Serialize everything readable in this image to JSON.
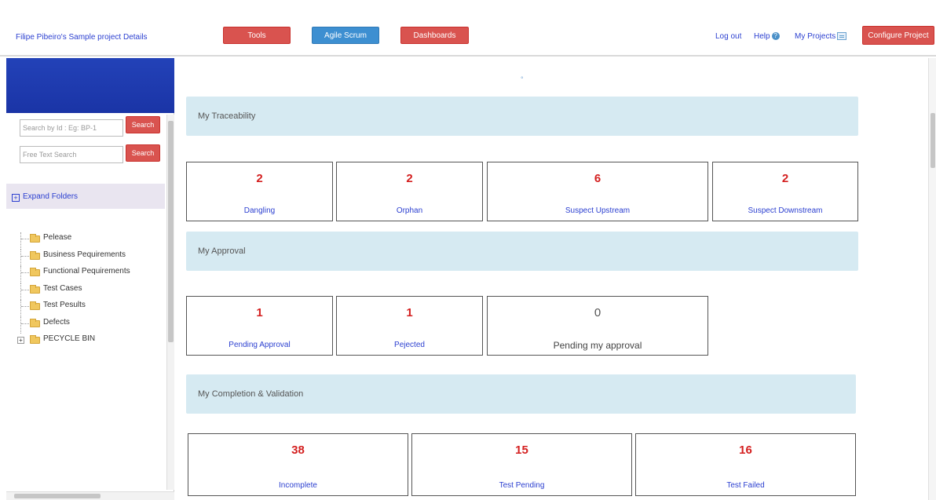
{
  "header": {
    "project_title": "Filipe Pibeiro's Sample project Details",
    "nav_buttons": [
      {
        "label": "Tools",
        "color": "#d9534f"
      },
      {
        "label": "Agile Scrum",
        "color": "#3d8fd1"
      },
      {
        "label": "Dashboards",
        "color": "#d9534f"
      }
    ],
    "logout": "Log out",
    "help": "Help",
    "my_projects": "My Projects",
    "configure_project": "Configure Project"
  },
  "sidebar": {
    "search_id_placeholder": "Search by Id : Eg: BP-1",
    "search_text_placeholder": "Free Text Search",
    "search_label": "Search",
    "expand_folders": "Expand Folders",
    "tree": [
      {
        "label": "Pelease",
        "icon": "folder-icon"
      },
      {
        "label": "Business Pequirements",
        "icon": "folder-icon"
      },
      {
        "label": "Functional Pequirements",
        "icon": "folder-icon"
      },
      {
        "label": "Test Cases",
        "icon": "folder-icon"
      },
      {
        "label": "Test Pesults",
        "icon": "folder-icon"
      },
      {
        "label": "Defects",
        "icon": "folder-icon"
      },
      {
        "label": "PECYCLE BIN",
        "icon": "folder-icon",
        "expandable": true
      }
    ]
  },
  "main": {
    "collapse_marker": "°",
    "sections": [
      {
        "title": "My Traceability",
        "cards": [
          {
            "value": "2",
            "label": "Dangling"
          },
          {
            "value": "2",
            "label": "Orphan"
          },
          {
            "value": "6",
            "label": "Suspect Upstream"
          },
          {
            "value": "2",
            "label": "Suspect Downstream"
          }
        ]
      },
      {
        "title": "My Approval",
        "cards": [
          {
            "value": "1",
            "label": "Pending Approval"
          },
          {
            "value": "1",
            "label": "Pejected"
          },
          {
            "value": "0",
            "label": "Pending my approval"
          }
        ]
      },
      {
        "title": "My Completion & Validation",
        "cards": [
          {
            "value": "38",
            "label": "Incomplete"
          },
          {
            "value": "15",
            "label": "Test Pending"
          },
          {
            "value": "16",
            "label": "Test Failed"
          }
        ]
      }
    ]
  },
  "colors": {
    "accent_red": "#d9534f",
    "accent_blue": "#3d8fd1",
    "count_red": "#d42020",
    "link_blue": "#2b3fd0",
    "section_bg": "#d6eaf2",
    "sidebar_banner": "#2342b8"
  }
}
